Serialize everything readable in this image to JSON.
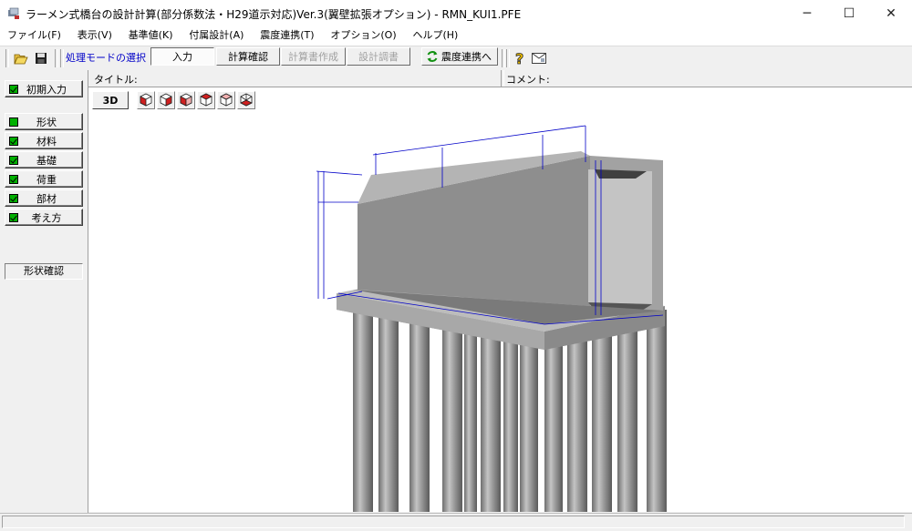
{
  "window": {
    "title": "ラーメン式橋台の設計計算(部分係数法・H29道示対応)Ver.3(翼壁拡張オプション) - RMN_KUI1.PFE",
    "minimize": "─",
    "maximize": "☐",
    "close": "✕"
  },
  "menu": [
    "ファイル(F)",
    "表示(V)",
    "基準値(K)",
    "付属設計(A)",
    "震度連携(T)",
    "オプション(O)",
    "ヘルプ(H)"
  ],
  "toolbar": {
    "mode_label": "処理モードの選択",
    "input": "入力",
    "calc_check": "計算確認",
    "calc_report": "計算書作成",
    "design_report": "設計調書",
    "seismic_link": "震度連携へ"
  },
  "sidebar": {
    "initial_input": "初期入力",
    "items": [
      "形状",
      "材料",
      "基礎",
      "荷重",
      "部材",
      "考え方"
    ],
    "shape_check": "形状確認"
  },
  "infobar": {
    "title_label": "タイトル:",
    "comment_label": "コメント:"
  },
  "viewport": {
    "btn_3d": "3D"
  },
  "colors": {
    "accent_blue": "#0000c8",
    "check_green": "#00b000",
    "view_cube_red": "#d02020"
  }
}
